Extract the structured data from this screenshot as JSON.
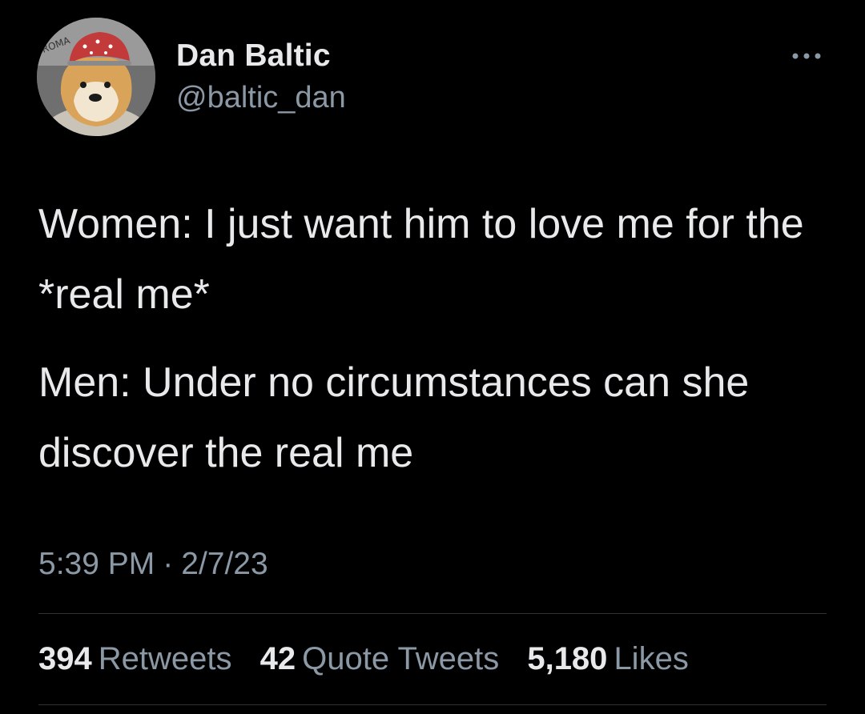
{
  "user": {
    "display_name": "Dan Baltic",
    "handle": "@baltic_dan",
    "avatar_icon": "doge-with-helmet-avatar"
  },
  "more_icon": "ellipsis-horizontal-icon",
  "tweet": {
    "paragraphs": [
      "Women: I just want him to love me for the *real me*",
      "Men: Under no circumstances can she discover the real me"
    ],
    "time": "5:39 PM",
    "separator": "·",
    "date": "2/7/23"
  },
  "stats": {
    "retweets": {
      "count": "394",
      "label": "Retweets"
    },
    "quotes": {
      "count": "42",
      "label": "Quote Tweets"
    },
    "likes": {
      "count": "5,180",
      "label": "Likes"
    }
  },
  "colors": {
    "background": "#000000",
    "primary_text": "#e7e9ea",
    "secondary_text": "#8b98a5",
    "divider": "#2f3336"
  }
}
